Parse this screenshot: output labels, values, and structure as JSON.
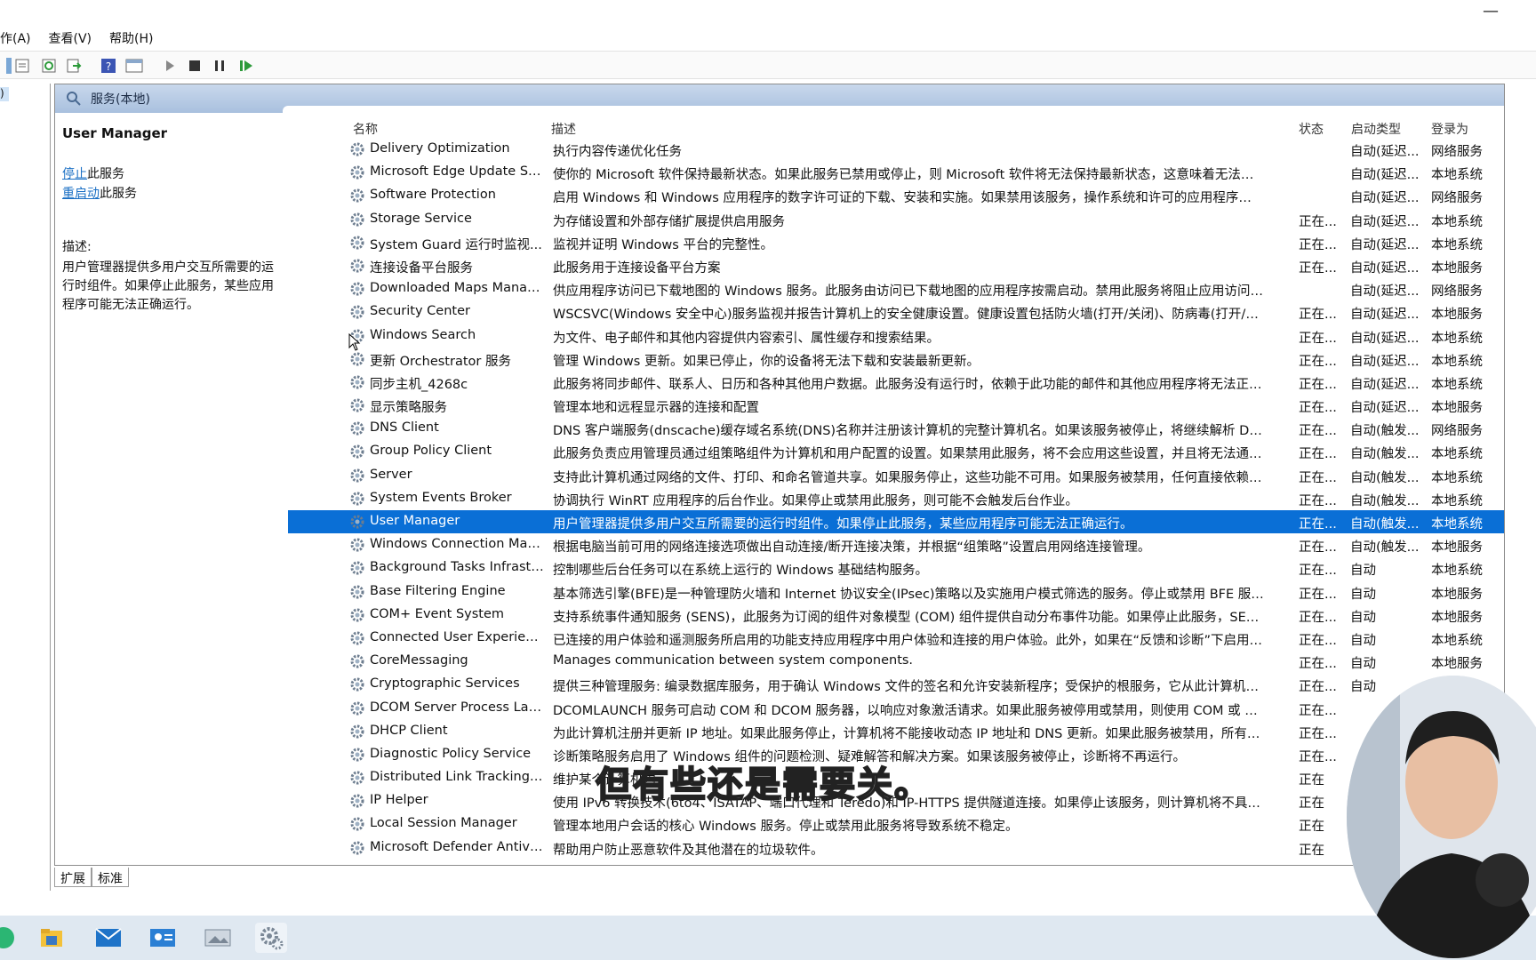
{
  "menu": [
    "作(A)",
    "查看(V)",
    "帮助(H)"
  ],
  "window_controls": {
    "minimize": "—"
  },
  "toolbar_icons": [
    "back-icon",
    "properties-icon",
    "refresh-icon",
    "export-icon",
    "help-icon",
    "console-view-icon",
    "start-icon",
    "stop-icon",
    "pause-icon",
    "restart-icon"
  ],
  "left_pane": {
    "fragment": ")"
  },
  "panel": {
    "title": "服务(本地)"
  },
  "detail": {
    "service_name": "User Manager",
    "stop_link": "停止",
    "stop_suffix": "此服务",
    "restart_link": "重启动",
    "restart_suffix": "此服务",
    "desc_label": "描述:",
    "desc_text": "用户管理器提供多用户交互所需要的运行时组件。如果停止此服务，某些应用程序可能无法正确运行。"
  },
  "columns": {
    "name": "名称",
    "desc": "描述",
    "status": "状态",
    "startup": "启动类型",
    "logon": "登录为"
  },
  "rows": [
    {
      "name": "Delivery Optimization",
      "desc": "执行内容传递优化任务",
      "status": "",
      "startup": "自动(延迟...",
      "logon": "网络服务"
    },
    {
      "name": "Microsoft Edge Update Ser...",
      "desc": "使你的 Microsoft 软件保持最新状态。如果此服务已禁用或停止，则 Microsoft 软件将无法保持最新状态，这意味着无法修复可能产生...",
      "status": "",
      "startup": "自动(延迟...",
      "logon": "本地系统"
    },
    {
      "name": "Software Protection",
      "desc": "启用 Windows 和 Windows 应用程序的数字许可证的下载、安装和实施。如果禁用该服务，操作系统和许可的应用程序可能以通知模...",
      "status": "",
      "startup": "自动(延迟...",
      "logon": "网络服务"
    },
    {
      "name": "Storage Service",
      "desc": "为存储设置和外部存储扩展提供启用服务",
      "status": "正在...",
      "startup": "自动(延迟...",
      "logon": "本地系统"
    },
    {
      "name": "System Guard 运行时监视...",
      "desc": "监视并证明 Windows 平台的完整性。",
      "status": "正在...",
      "startup": "自动(延迟...",
      "logon": "本地系统"
    },
    {
      "name": "连接设备平台服务",
      "desc": "此服务用于连接设备平台方案",
      "status": "正在...",
      "startup": "自动(延迟...",
      "logon": "本地服务"
    },
    {
      "name": "Downloaded Maps Manager",
      "desc": "供应用程序访问已下载地图的 Windows 服务。此服务由访问已下载地图的应用程序按需启动。禁用此服务将阻止应用访问地图。",
      "status": "",
      "startup": "自动(延迟...",
      "logon": "网络服务"
    },
    {
      "name": "Security Center",
      "desc": "WSCSVC(Windows 安全中心)服务监视并报告计算机上的安全健康设置。健康设置包括防火墙(打开/关闭)、防病毒(打开/关闭/过期)、...",
      "status": "正在...",
      "startup": "自动(延迟...",
      "logon": "本地服务"
    },
    {
      "name": "Windows Search",
      "desc": "为文件、电子邮件和其他内容提供内容索引、属性缓存和搜索结果。",
      "status": "正在...",
      "startup": "自动(延迟...",
      "logon": "本地系统"
    },
    {
      "name": "更新 Orchestrator 服务",
      "desc": "管理 Windows 更新。如果已停止，你的设备将无法下载和安装最新更新。",
      "status": "正在...",
      "startup": "自动(延迟...",
      "logon": "本地系统"
    },
    {
      "name": "同步主机_4268c",
      "desc": "此服务将同步邮件、联系人、日历和各种其他用户数据。此服务没有运行时，依赖于此功能的邮件和其他应用程序将无法正常工作。",
      "status": "正在...",
      "startup": "自动(延迟...",
      "logon": "本地系统"
    },
    {
      "name": "显示策略服务",
      "desc": "管理本地和远程显示器的连接和配置",
      "status": "正在...",
      "startup": "自动(延迟...",
      "logon": "本地服务"
    },
    {
      "name": "DNS Client",
      "desc": "DNS 客户端服务(dnscache)缓存域名系统(DNS)名称并注册该计算机的完整计算机名。如果该服务被停止，将继续解析 DNS 名称。然...",
      "status": "正在...",
      "startup": "自动(触发...",
      "logon": "网络服务"
    },
    {
      "name": "Group Policy Client",
      "desc": "此服务负责应用管理员通过组策略组件为计算机和用户配置的设置。如果禁用此服务，将不会应用这些设置，并且将无法通过组策略管...",
      "status": "正在...",
      "startup": "自动(触发...",
      "logon": "本地系统"
    },
    {
      "name": "Server",
      "desc": "支持此计算机通过网络的文件、打印、和命名管道共享。如果服务停止，这些功能不可用。如果服务被禁用，任何直接依赖于此服务的...",
      "status": "正在...",
      "startup": "自动(触发...",
      "logon": "本地系统"
    },
    {
      "name": "System Events Broker",
      "desc": "协调执行 WinRT 应用程序的后台作业。如果停止或禁用此服务，则可能不会触发后台作业。",
      "status": "正在...",
      "startup": "自动(触发...",
      "logon": "本地系统"
    },
    {
      "name": "User Manager",
      "desc": "用户管理器提供多用户交互所需要的运行时组件。如果停止此服务，某些应用程序可能无法正确运行。",
      "status": "正在...",
      "startup": "自动(触发...",
      "logon": "本地系统",
      "selected": true
    },
    {
      "name": "Windows Connection Man...",
      "desc": "根据电脑当前可用的网络连接选项做出自动连接/断开连接决策，并根据“组策略”设置启用网络连接管理。",
      "status": "正在...",
      "startup": "自动(触发...",
      "logon": "本地服务"
    },
    {
      "name": "Background Tasks Infrastru...",
      "desc": "控制哪些后台任务可以在系统上运行的 Windows 基础结构服务。",
      "status": "正在...",
      "startup": "自动",
      "logon": "本地系统"
    },
    {
      "name": "Base Filtering Engine",
      "desc": "基本筛选引擎(BFE)是一种管理防火墙和 Internet 协议安全(IPsec)策略以及实施用户模式筛选的服务。停止或禁用 BFE 服务将大大降低...",
      "status": "正在...",
      "startup": "自动",
      "logon": "本地服务"
    },
    {
      "name": "COM+ Event System",
      "desc": "支持系统事件通知服务 (SENS)，此服务为订阅的组件对象模型 (COM) 组件提供自动分布事件功能。如果停止此服务，SENS 将关闭，...",
      "status": "正在...",
      "startup": "自动",
      "logon": "本地服务"
    },
    {
      "name": "Connected User Experienc...",
      "desc": "已连接的用户体验和遥测服务所启用的功能支持应用程序中用户体验和连接的用户体验。此外，如果在“反馈和诊断”下启用诊断和使用...",
      "status": "正在...",
      "startup": "自动",
      "logon": "本地系统"
    },
    {
      "name": "CoreMessaging",
      "desc": "Manages communication between system components.",
      "status": "正在...",
      "startup": "自动",
      "logon": "本地服务"
    },
    {
      "name": "Cryptographic Services",
      "desc": "提供三种管理服务: 编录数据库服务，用于确认 Windows 文件的签名和允许安装新程序；受保护的根服务，它从此计算机添加和删除受...",
      "status": "正在...",
      "startup": "自动",
      "logon": ""
    },
    {
      "name": "DCOM Server Process Lau...",
      "desc": "DCOMLAUNCH 服务可启动 COM 和 DCOM 服务器，以响应对象激活请求。如果此服务被停用或禁用，则使用 COM 或 DCOM 的程...",
      "status": "正在...",
      "startup": "",
      "logon": ""
    },
    {
      "name": "DHCP Client",
      "desc": "为此计算机注册并更新 IP 地址。如果此服务停止，计算机将不能接收动态 IP 地址和 DNS 更新。如果此服务被禁用，所有明确依赖它...",
      "status": "正在...",
      "startup": "",
      "logon": ""
    },
    {
      "name": "Diagnostic Policy Service",
      "desc": "诊断策略服务启用了 Windows 组件的问题检测、疑难解答和解决方案。如果该服务被停止，诊断将不再运行。",
      "status": "正在...",
      "startup": "",
      "logon": ""
    },
    {
      "name": "Distributed Link Tracking C...",
      "desc": "维护某个计算机内",
      "status": "正在",
      "startup": "",
      "logon": ""
    },
    {
      "name": "IP Helper",
      "desc": "使用 IPv6 转换技术(6to4、ISATAP、端口代理和 Teredo)和 IP-HTTPS 提供隧道连接。如果停止该服务，则计算机将不具备这些技术提...",
      "status": "正在",
      "startup": "",
      "logon": ""
    },
    {
      "name": "Local Session Manager",
      "desc": "管理本地用户会话的核心 Windows 服务。停止或禁用此服务将导致系统不稳定。",
      "status": "正在",
      "startup": "",
      "logon": ""
    },
    {
      "name": "Microsoft Defender Antivir...",
      "desc": "帮助用户防止恶意软件及其他潜在的垃圾软件。",
      "status": "正在",
      "startup": "",
      "logon": ""
    }
  ],
  "tabs": [
    "扩展",
    "标准"
  ],
  "subtitle": "但有些还是需要关。",
  "taskbar_icons": [
    "browser-icon",
    "file-explorer-icon",
    "mail-icon",
    "contacts-icon",
    "photos-icon",
    "services-icon"
  ]
}
